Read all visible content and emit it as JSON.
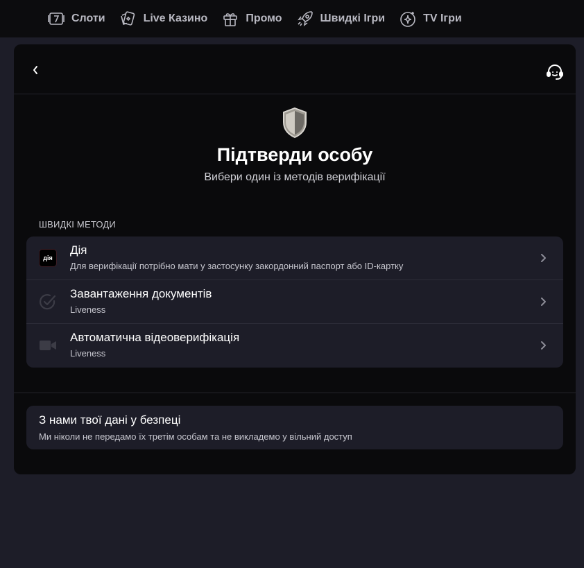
{
  "nav": {
    "items": [
      {
        "label": "Слоти",
        "icon": "slot-seven-icon"
      },
      {
        "label": "Live Казино",
        "icon": "cards-icon"
      },
      {
        "label": "Промо",
        "icon": "gift-icon"
      },
      {
        "label": "Швидкі Ігри",
        "icon": "rocket-icon"
      },
      {
        "label": "TV Ігри",
        "icon": "sparkle-icon"
      }
    ]
  },
  "header": {
    "back_icon": "chevron-left-icon",
    "support_icon": "headset-support-icon"
  },
  "hero": {
    "icon": "shield-icon",
    "title": "Підтверди особу",
    "subtitle": "Вибери один із методів верифікації"
  },
  "methods": {
    "section_label": "ШВИДКІ МЕТОДИ",
    "items": [
      {
        "title": "Дія",
        "subtitle": "Для верифікації потрібно мати у застосунку закордонний паспорт або ID-картку",
        "icon": "diia-logo",
        "logo_text": "дія"
      },
      {
        "title": "Завантаження документів",
        "subtitle": "Liveness",
        "icon": "check-circle-icon"
      },
      {
        "title": "Автоматична відеоверифікація",
        "subtitle": "Liveness",
        "icon": "video-camera-icon"
      }
    ]
  },
  "safety": {
    "title": "З нами твої дані у безпеці",
    "text": "Ми ніколи не передамо їх третім особам та не викладемо у вільний доступ"
  },
  "colors": {
    "page_bg": "#1d1d28",
    "modal_bg": "#0a0a0c",
    "card_bg": "#1d1d28",
    "nav_bg": "#0c0c0e",
    "text_muted": "#c8c8d0"
  }
}
